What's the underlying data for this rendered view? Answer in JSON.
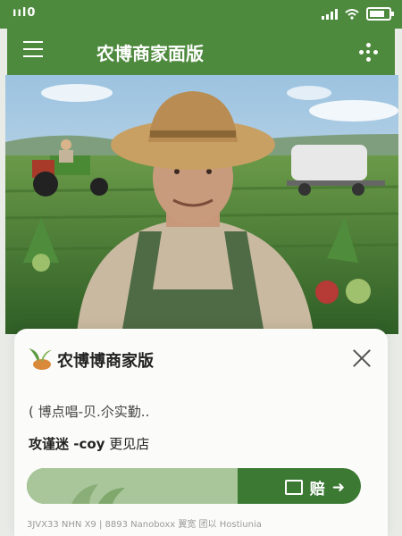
{
  "status_bar": {
    "carrier": "ııl0",
    "wifi": "wifi-icon",
    "signal": "signal-icon",
    "battery": "battery-icon"
  },
  "header": {
    "title": "农博商家面版",
    "menu_icon": "menu-icon",
    "more_icon": "more-icon"
  },
  "hero": {
    "image": "farmer-in-field-photo"
  },
  "card": {
    "logo": "sprout-logo-icon",
    "title": "农博博商家版",
    "description": "( 博点唱-贝.尒实勤..",
    "store_address": "攻谨迷 -coy",
    "store_link": "更见店",
    "cta_label": "赔",
    "cta_progress": 0.63,
    "footer": "3JVX33 NHN X9 | 8893 Nanoboxx 翼宽 团以 Hostiunia"
  },
  "colors": {
    "brand_green": "#4e8a3e",
    "cta_dark": "#3c7a34",
    "cta_light": "#a8c69a"
  }
}
